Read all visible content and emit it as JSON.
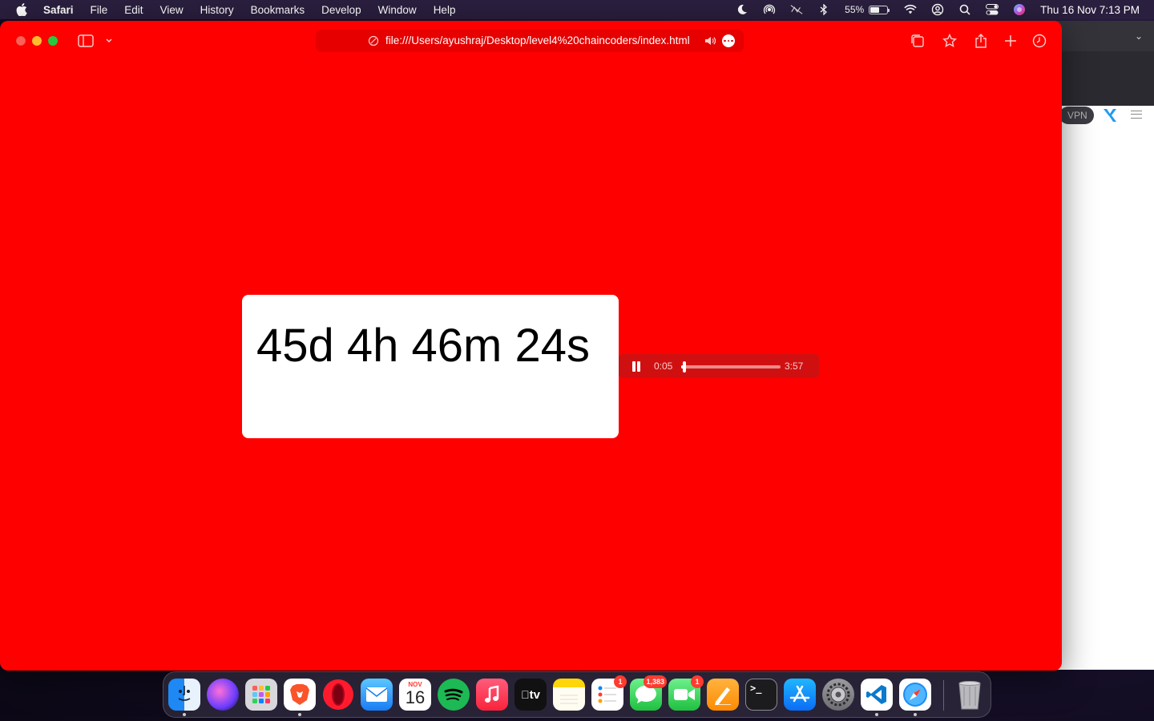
{
  "menubar": {
    "app_name": "Safari",
    "items": [
      "File",
      "Edit",
      "View",
      "History",
      "Bookmarks",
      "Develop",
      "Window",
      "Help"
    ],
    "battery_percent": "55%",
    "battery_level": 0.55,
    "clock": "Thu 16 Nov  7:13 PM"
  },
  "browser": {
    "url": "file:///Users/ayushraj/Desktop/level4%20chaincoders/index.html",
    "page_background": "#ff0000"
  },
  "page": {
    "countdown": "45d 4h 46m 24s"
  },
  "audio_player": {
    "current_time": "0:05",
    "duration": "3:57",
    "progress": 0.021
  },
  "background_window": {
    "vpn_label": "VPN"
  },
  "dock": {
    "calendar_month": "NOV",
    "calendar_day": "16",
    "reminders_badge": "1",
    "messages_badge": "1,383",
    "facetime_badge": "1",
    "appletv_label": "tv"
  }
}
